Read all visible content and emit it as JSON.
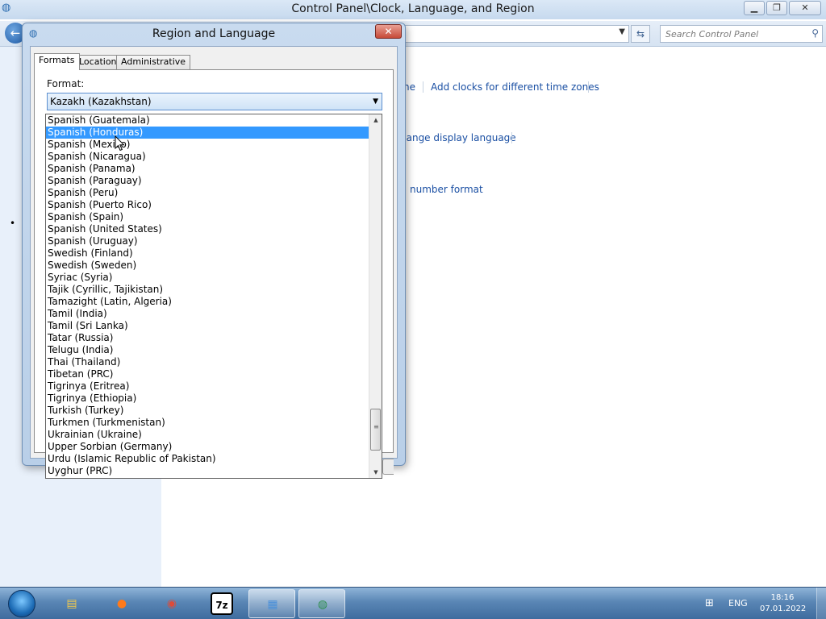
{
  "control_panel": {
    "title": "Control Panel\\Clock, Language, and Region",
    "search_placeholder": "Search Control Panel",
    "links": {
      "time_zone_tail": "ne",
      "add_clocks": "Add clocks for different time zones",
      "display_language": "hange display language",
      "number_format": "number format"
    }
  },
  "dialog": {
    "title": "Region and Language",
    "tabs": [
      "Formats",
      "Location",
      "Administrative"
    ],
    "format_label": "Format:",
    "format_selected": "Kazakh (Kazakhstan)",
    "options": [
      "Spanish (Guatemala)",
      "Spanish (Honduras)",
      "Spanish (Mexico)",
      "Spanish (Nicaragua)",
      "Spanish (Panama)",
      "Spanish (Paraguay)",
      "Spanish (Peru)",
      "Spanish (Puerto Rico)",
      "Spanish (Spain)",
      "Spanish (United States)",
      "Spanish (Uruguay)",
      "Swedish (Finland)",
      "Swedish (Sweden)",
      "Syriac (Syria)",
      "Tajik (Cyrillic, Tajikistan)",
      "Tamazight (Latin, Algeria)",
      "Tamil (India)",
      "Tamil (Sri Lanka)",
      "Tatar (Russia)",
      "Telugu (India)",
      "Thai (Thailand)",
      "Tibetan (PRC)",
      "Tigrinya (Eritrea)",
      "Tigrinya (Ethiopia)",
      "Turkish (Turkey)",
      "Turkmen (Turkmenistan)",
      "Ukrainian (Ukraine)",
      "Upper Sorbian (Germany)",
      "Urdu (Islamic Republic of Pakistan)",
      "Uyghur (PRC)"
    ],
    "highlighted_index": 1
  },
  "taskbar": {
    "items": [
      {
        "name": "explorer-icon",
        "glyph": "▤",
        "color": "#f2c94c"
      },
      {
        "name": "firefox-icon",
        "glyph": "●",
        "color": "#ff7a1a"
      },
      {
        "name": "chrome-icon",
        "glyph": "◉",
        "color": "#dd4b39"
      },
      {
        "name": "7zip-icon",
        "glyph": "7z",
        "color": "#000000"
      },
      {
        "name": "control-panel-icon",
        "glyph": "▦",
        "color": "#4a90d9"
      },
      {
        "name": "region-language-icon",
        "glyph": "◍",
        "color": "#2f8f4f"
      }
    ],
    "language": "ENG",
    "time": "18:16",
    "date": "07.01.2022"
  },
  "colors": {
    "selection": "#3399ff",
    "link": "#1a4fa3"
  }
}
